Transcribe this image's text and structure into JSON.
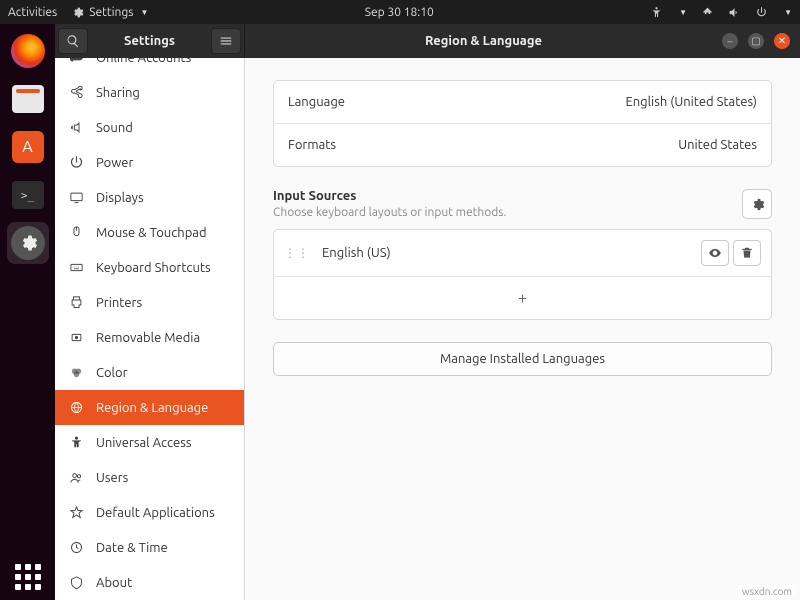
{
  "topbar": {
    "activities": "Activities",
    "appmenu": "Settings",
    "clock": "Sep 30  18:10"
  },
  "dock": {
    "items": [
      "firefox",
      "files",
      "software",
      "terminal",
      "settings"
    ]
  },
  "titlebar": {
    "left_title": "Settings",
    "right_title": "Region & Language"
  },
  "sidebar": {
    "items": [
      {
        "icon": "cloud",
        "label": "Online Accounts"
      },
      {
        "icon": "share",
        "label": "Sharing"
      },
      {
        "icon": "sound",
        "label": "Sound"
      },
      {
        "icon": "power",
        "label": "Power"
      },
      {
        "icon": "displays",
        "label": "Displays"
      },
      {
        "icon": "mouse",
        "label": "Mouse & Touchpad"
      },
      {
        "icon": "keyboard",
        "label": "Keyboard Shortcuts"
      },
      {
        "icon": "printer",
        "label": "Printers"
      },
      {
        "icon": "media",
        "label": "Removable Media"
      },
      {
        "icon": "color",
        "label": "Color"
      },
      {
        "icon": "region",
        "label": "Region & Language",
        "active": true
      },
      {
        "icon": "access",
        "label": "Universal Access"
      },
      {
        "icon": "users",
        "label": "Users"
      },
      {
        "icon": "star",
        "label": "Default Applications"
      },
      {
        "icon": "clock",
        "label": "Date & Time"
      },
      {
        "icon": "about",
        "label": "About"
      }
    ]
  },
  "content": {
    "language_label": "Language",
    "language_value": "English (United States)",
    "formats_label": "Formats",
    "formats_value": "United States",
    "input_sources_title": "Input Sources",
    "input_sources_sub": "Choose keyboard layouts or input methods.",
    "input_sources": [
      {
        "label": "English (US)"
      }
    ],
    "add_label": "+",
    "manage_label": "Manage Installed Languages"
  },
  "watermark": "wsxdn.com"
}
